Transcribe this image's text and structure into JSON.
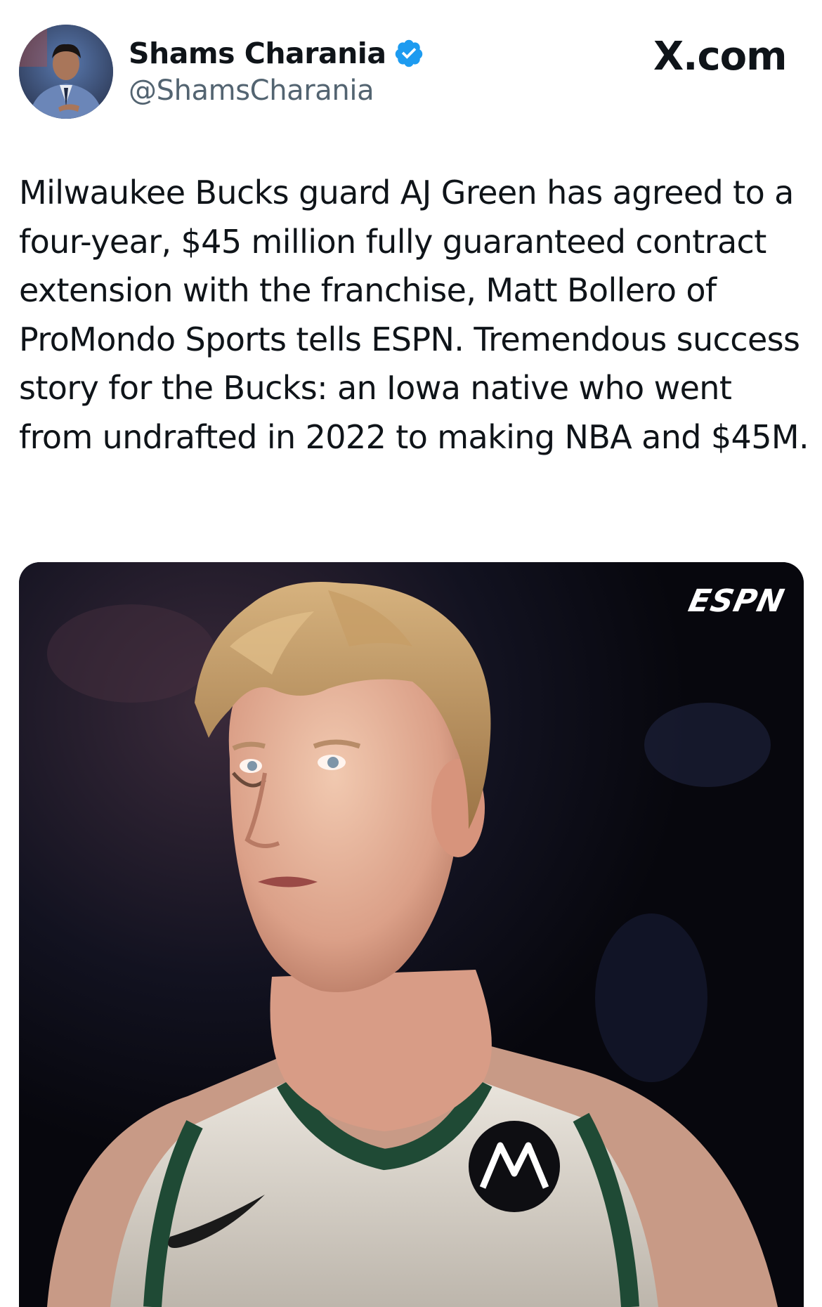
{
  "author": {
    "display_name": "Shams Charania",
    "handle": "@ShamsCharania",
    "verified": true,
    "avatar_icon": "person-in-suit-avatar"
  },
  "source_label": "X.com",
  "tweet": {
    "text": "Milwaukee Bucks guard AJ Green has agreed to a four-year, $45 million fully guaranteed contract extension with the franchise, Matt Bollero of ProMondo Sports tells ESPN. Tremendous success story for the Bucks: an Iowa native who went from undrafted in 2022 to making NBA and $45M."
  },
  "media": {
    "watermark": "ESPN",
    "description_icon": "basketball-player-photo"
  },
  "colors": {
    "verified_blue": "#1d9bf0",
    "handle_gray": "#536471",
    "text_black": "#0f1419",
    "jersey_green": "#1f4a35"
  }
}
